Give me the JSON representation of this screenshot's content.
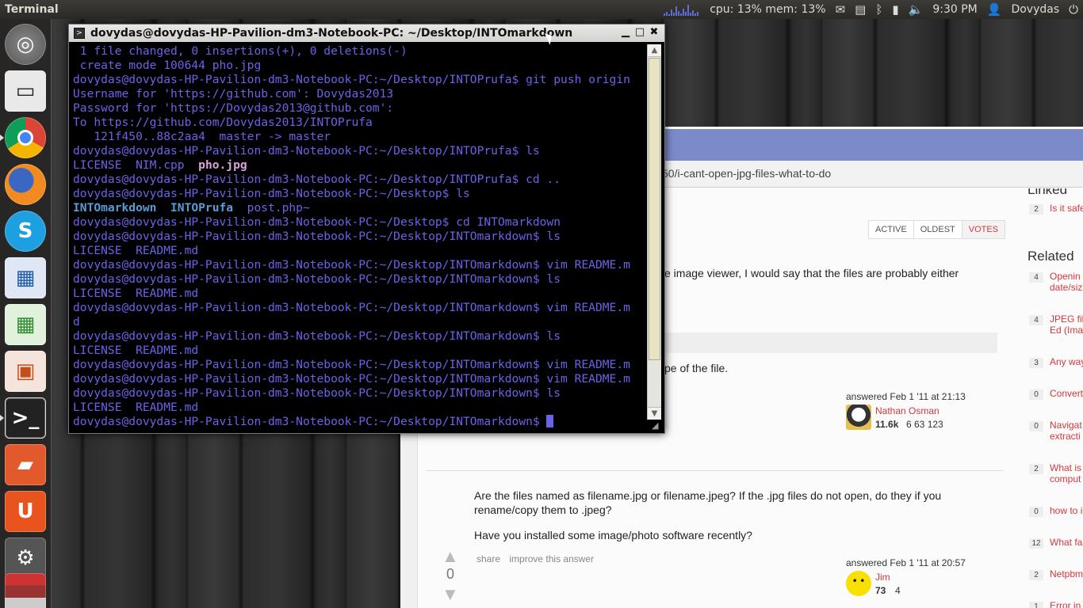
{
  "top_panel": {
    "app_title": "Terminal",
    "cpu_mem": "cpu: 13% mem: 13%",
    "time": "9:30 PM",
    "user": "Dovydas",
    "icons": [
      "mail-icon",
      "clipboard-icon",
      "bluetooth-icon",
      "signal-icon",
      "volume-icon",
      "user-icon",
      "system-icon"
    ]
  },
  "launcher": {
    "items": [
      "dash-home",
      "files",
      "chrome",
      "firefox",
      "skype",
      "libreoffice-draw",
      "libreoffice-calc",
      "libreoffice-impress",
      "terminal",
      "software-center",
      "ubuntu-one",
      "system-settings",
      "stacked-apps"
    ]
  },
  "terminal": {
    "title": "dovydas@dovydas-HP-Pavilion-dm3-Notebook-PC: ~/Desktop/INTOmarkdown",
    "lines": [
      {
        "text": " 1 file changed, 0 insertions(+), 0 deletions(-)"
      },
      {
        "text": " create mode 100644 pho.jpg"
      },
      {
        "text": "dovydas@dovydas-HP-Pavilion-dm3-Notebook-PC:~/Desktop/INTOPrufa$ git push origin"
      },
      {
        "text": "Username for 'https://github.com': Dovydas2013"
      },
      {
        "text": "Password for 'https://Dovydas2013@github.com':"
      },
      {
        "text": "To https://github.com/Dovydas2013/INTOPrufa"
      },
      {
        "text": "   121f450..88c2aa4  master -> master"
      },
      {
        "text": "dovydas@dovydas-HP-Pavilion-dm3-Notebook-PC:~/Desktop/INTOPrufa$ ls"
      },
      {
        "text": "LICENSE  NIM.cpp  ",
        "pink": "pho.jpg"
      },
      {
        "text": "dovydas@dovydas-HP-Pavilion-dm3-Notebook-PC:~/Desktop/INTOPrufa$ cd .."
      },
      {
        "text": "dovydas@dovydas-HP-Pavilion-dm3-Notebook-PC:~/Desktop$ ls"
      },
      {
        "dirs": "INTOmarkdown  INTOPrufa",
        "rest": "  post.php~"
      },
      {
        "text": "dovydas@dovydas-HP-Pavilion-dm3-Notebook-PC:~/Desktop$ cd INTOmarkdown"
      },
      {
        "text": "dovydas@dovydas-HP-Pavilion-dm3-Notebook-PC:~/Desktop/INTOmarkdown$ ls"
      },
      {
        "text": "LICENSE  README.md"
      },
      {
        "text": "dovydas@dovydas-HP-Pavilion-dm3-Notebook-PC:~/Desktop/INTOmarkdown$ vim README.m"
      },
      {
        "text": "dovydas@dovydas-HP-Pavilion-dm3-Notebook-PC:~/Desktop/INTOmarkdown$ ls"
      },
      {
        "text": "LICENSE  README.md"
      },
      {
        "text": "dovydas@dovydas-HP-Pavilion-dm3-Notebook-PC:~/Desktop/INTOmarkdown$ vim README.m"
      },
      {
        "text": "d"
      },
      {
        "text": "dovydas@dovydas-HP-Pavilion-dm3-Notebook-PC:~/Desktop/INTOmarkdown$ ls"
      },
      {
        "text": "LICENSE  README.md"
      },
      {
        "text": "dovydas@dovydas-HP-Pavilion-dm3-Notebook-PC:~/Desktop/INTOmarkdown$ vim README.m"
      },
      {
        "text": "dovydas@dovydas-HP-Pavilion-dm3-Notebook-PC:~/Desktop/INTOmarkdown$ vim README.m"
      },
      {
        "text": "dovydas@dovydas-HP-Pavilion-dm3-Notebook-PC:~/Desktop/INTOmarkdown$ ls"
      },
      {
        "text": "LICENSE  README.md"
      },
      {
        "text": "dovydas@dovydas-HP-Pavilion-dm3-Notebook-PC:~/Desktop/INTOmarkdown$ ",
        "cursor": true
      }
    ]
  },
  "browser": {
    "url_fragment": "50/i-cant-open-jpg-files-what-to-do",
    "sort_tabs": [
      "ACTIVE",
      "OLDEST",
      "VOTES"
    ],
    "answer1": {
      "line1": "e image viewer, I would say that the files are probably either",
      "line2": "pe of the file.",
      "answered": "answered Feb 1 '11 at 21:13",
      "user": "Nathan Osman",
      "rep": "11.6k",
      "badges": "6  63  123"
    },
    "answer2": {
      "votes": "0",
      "line1": "Are the files named as filename.jpg or filename.jpeg? If the .jpg files do not open, do they if you",
      "line2": "rename/copy them to .jpeg?",
      "line3": "Have you installed some image/photo software recently?",
      "share": "share",
      "improve": "improve this answer",
      "answered": "answered Feb 1 '11 at 20:57",
      "user": "Jim",
      "rep": "73",
      "badges": "4"
    },
    "sidebar": {
      "linked_header": "Linked",
      "linked": [
        {
          "count": "2",
          "text": "Is it safe images"
        }
      ],
      "related_header": "Related",
      "related": [
        {
          "count": "4",
          "text": "Openin modific date/siz"
        },
        {
          "count": "4",
          "text": "JPEG fil (Hex Ed (Image"
        },
        {
          "count": "3",
          "text": "Any way compre"
        },
        {
          "count": "0",
          "text": "Convert format"
        },
        {
          "count": "0",
          "text": "Navigat Compre extracti"
        },
        {
          "count": "2",
          "text": "What is image U comput"
        },
        {
          "count": "0",
          "text": "how to image f"
        },
        {
          "count": "12",
          "text": "What fa availabl"
        },
        {
          "count": "2",
          "text": "Netpbm support"
        },
        {
          "count": "1",
          "text": "Error in"
        }
      ]
    }
  }
}
